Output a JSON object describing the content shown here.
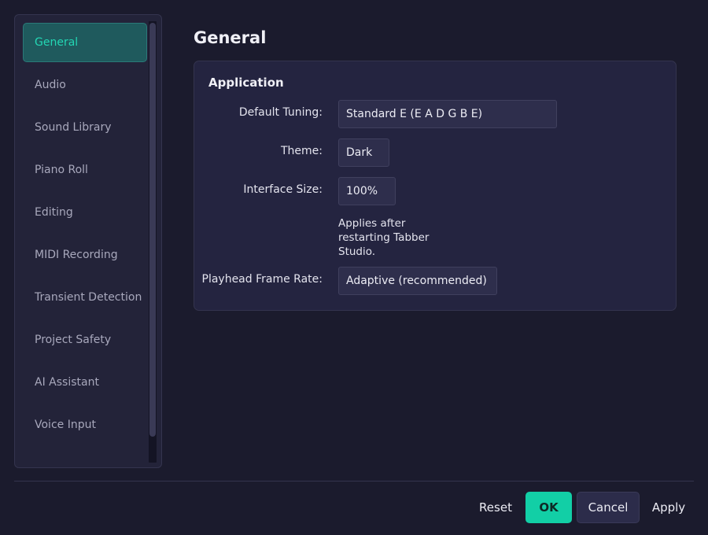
{
  "sidebar": {
    "items": [
      {
        "label": "General",
        "active": true
      },
      {
        "label": "Audio"
      },
      {
        "label": "Sound Library"
      },
      {
        "label": "Piano Roll"
      },
      {
        "label": "Editing"
      },
      {
        "label": "MIDI Recording"
      },
      {
        "label": "Transient Detection"
      },
      {
        "label": "Project Safety"
      },
      {
        "label": "AI Assistant"
      },
      {
        "label": "Voice Input"
      }
    ]
  },
  "main": {
    "title": "General",
    "section": {
      "title": "Application",
      "default_tuning": {
        "label": "Default Tuning:",
        "value": "Standard E (E A D G B E)"
      },
      "theme": {
        "label": "Theme:",
        "value": "Dark"
      },
      "interface_size": {
        "label": "Interface Size:",
        "value": "100%",
        "hint": "Applies after restarting Tabber Studio."
      },
      "playhead_frame_rate": {
        "label": "Playhead Frame Rate:",
        "value": "Adaptive (recommended)"
      }
    }
  },
  "footer": {
    "reset_label": "Reset",
    "ok_label": "OK",
    "cancel_label": "Cancel",
    "apply_label": "Apply"
  },
  "colors": {
    "accent": "#12cfa6",
    "background": "#1b1b2d",
    "panel": "#242440"
  }
}
